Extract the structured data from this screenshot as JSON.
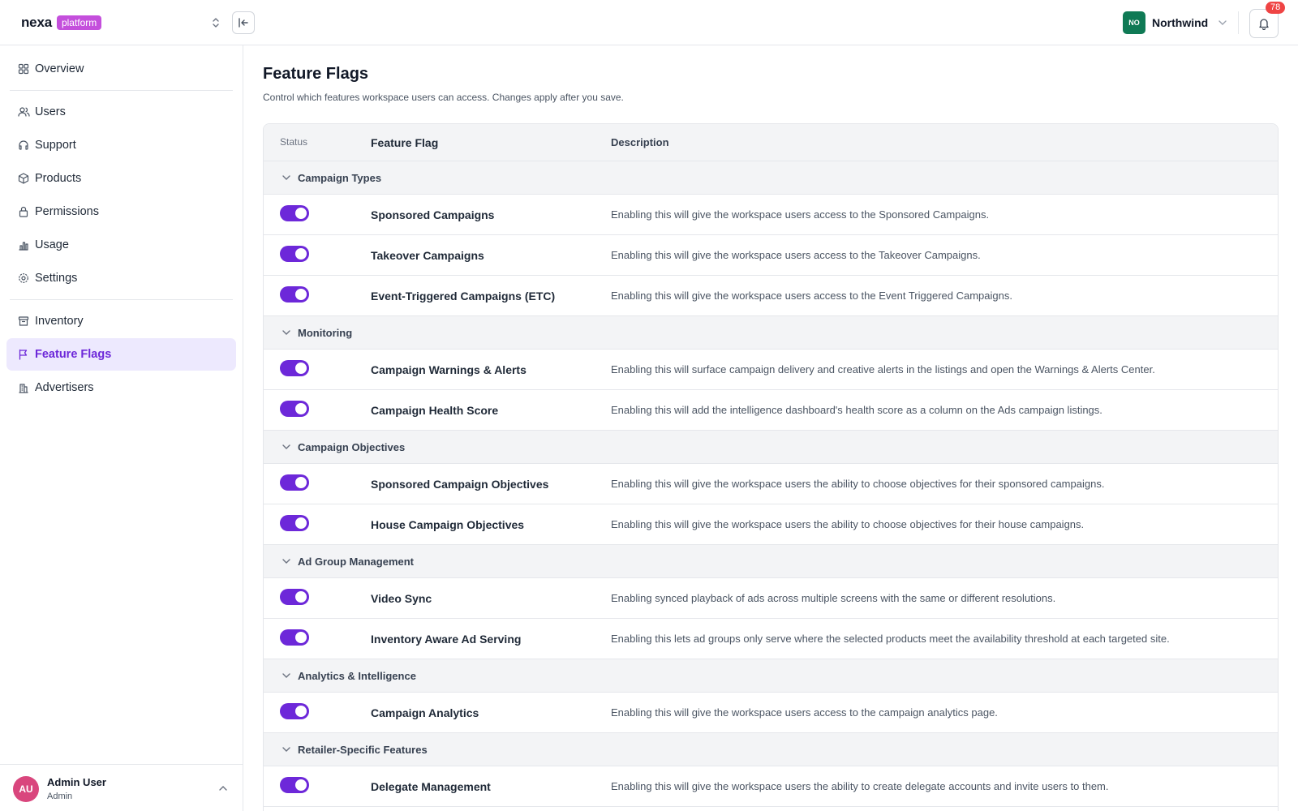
{
  "brand": {
    "name": "nexa",
    "badge": "platform"
  },
  "org": {
    "initials": "NO",
    "name": "Northwind"
  },
  "notifications": {
    "count": "78"
  },
  "sidebar": {
    "items": [
      {
        "label": "Overview",
        "icon": "grid-icon"
      },
      {
        "label": "Users",
        "icon": "users-icon"
      },
      {
        "label": "Support",
        "icon": "headset-icon"
      },
      {
        "label": "Products",
        "icon": "box-icon"
      },
      {
        "label": "Permissions",
        "icon": "lock-icon"
      },
      {
        "label": "Usage",
        "icon": "bar-chart-icon"
      },
      {
        "label": "Settings",
        "icon": "gear-icon"
      },
      {
        "label": "Inventory",
        "icon": "archive-icon"
      },
      {
        "label": "Feature Flags",
        "icon": "flag-icon",
        "active": true
      },
      {
        "label": "Advertisers",
        "icon": "building-icon"
      }
    ]
  },
  "user": {
    "initials": "AU",
    "name": "Admin User",
    "role": "Admin"
  },
  "page": {
    "title": "Feature Flags",
    "subtitle": "Control which features workspace users can access. Changes apply after you save."
  },
  "table": {
    "headers": {
      "status": "Status",
      "flag": "Feature Flag",
      "description": "Description"
    },
    "groups": [
      {
        "label": "Campaign Types",
        "flags": [
          {
            "name": "Sponsored Campaigns",
            "description": "Enabling this will give the workspace users access to the Sponsored Campaigns.",
            "enabled": true
          },
          {
            "name": "Takeover Campaigns",
            "description": "Enabling this will give the workspace users access to the Takeover Campaigns.",
            "enabled": true
          },
          {
            "name": "Event-Triggered Campaigns (ETC)",
            "description": "Enabling this will give the workspace users access to the Event Triggered Campaigns.",
            "enabled": true
          }
        ]
      },
      {
        "label": "Monitoring",
        "flags": [
          {
            "name": "Campaign Warnings & Alerts",
            "description": "Enabling this will surface campaign delivery and creative alerts in the listings and open the Warnings & Alerts Center.",
            "enabled": true
          },
          {
            "name": "Campaign Health Score",
            "description": "Enabling this will add the intelligence dashboard's health score as a column on the Ads campaign listings.",
            "enabled": true
          }
        ]
      },
      {
        "label": "Campaign Objectives",
        "flags": [
          {
            "name": "Sponsored Campaign Objectives",
            "description": "Enabling this will give the workspace users the ability to choose objectives for their sponsored campaigns.",
            "enabled": true
          },
          {
            "name": "House Campaign Objectives",
            "description": "Enabling this will give the workspace users the ability to choose objectives for their house campaigns.",
            "enabled": true
          }
        ]
      },
      {
        "label": "Ad Group Management",
        "flags": [
          {
            "name": "Video Sync",
            "description": "Enabling synced playback of ads across multiple screens with the same or different resolutions.",
            "enabled": true
          },
          {
            "name": "Inventory Aware Ad Serving",
            "description": "Enabling this lets ad groups only serve where the selected products meet the availability threshold at each targeted site.",
            "enabled": true
          }
        ]
      },
      {
        "label": "Analytics & Intelligence",
        "flags": [
          {
            "name": "Campaign Analytics",
            "description": "Enabling this will give the workspace users access to the campaign analytics page.",
            "enabled": true
          }
        ]
      },
      {
        "label": "Retailer-Specific Features",
        "flags": [
          {
            "name": "Delegate Management",
            "description": "Enabling this will give the workspace users the ability to create delegate accounts and invite users to them.",
            "enabled": true
          }
        ]
      }
    ]
  },
  "colors": {
    "accent": "#6d28d9",
    "brand_badge": "#c44fdc",
    "org_avatar": "#0f7a55",
    "user_avatar": "#d9467d",
    "badge": "#ef4444"
  }
}
